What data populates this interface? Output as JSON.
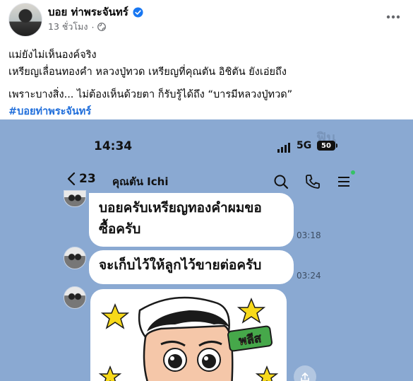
{
  "post": {
    "author": "บอย ท่าพระจันทร์",
    "time": "13 ชั่วโมง",
    "lines": [
      "แม่ยังไม่เห็นองค์จริง",
      "เหรียญเลื่อนทองคำ หลวงปู่ทวด  เหรียญที่คุณตัน อิชิตัน ยังเอ่ยถึง",
      "เพราะบางสิ่ง... ไม่ต้องเห็นด้วยตา ก็รับรู้ได้ถึง “บารมีหลวงปู่ทวด”"
    ],
    "hashtag": "#บอยท่าพระจันทร์"
  },
  "screenshot": {
    "status_time": "14:34",
    "network": "5G",
    "battery": "50",
    "chat": {
      "back_count": "23",
      "contact_name": "คุณตัน Ichi"
    },
    "messages": [
      {
        "text_line1": "บอยครับเหรียญทองคำผมขอ",
        "text_line2": "ซื้อครับ",
        "time": "03:18"
      },
      {
        "text_line1": "จะเก็บไว้ให้ลูกไว้ขายต่อครับ",
        "time": "03:24"
      }
    ],
    "sticker_text": "พลีส"
  },
  "icons": {
    "verified": "verified-badge-icon",
    "globe": "globe-icon",
    "more": "more-dots-icon",
    "back": "chevron-left-icon",
    "search": "search-icon",
    "call": "phone-icon",
    "menu": "menu-icon",
    "share": "share-icon"
  },
  "colors": {
    "facebook_blue": "#216fdb",
    "line_chat_bg": "#8aa9d2",
    "bubble": "#ffffff"
  }
}
